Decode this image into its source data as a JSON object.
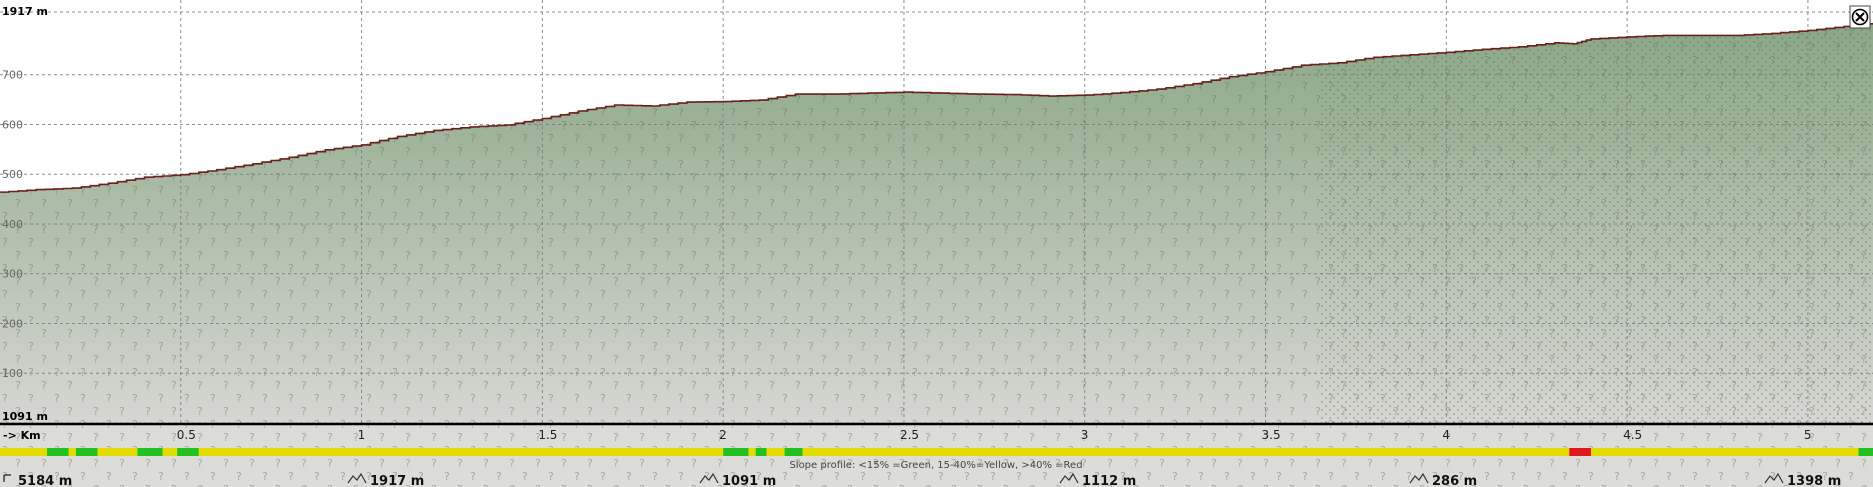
{
  "window": {
    "close_icon": "close-icon"
  },
  "chart_data": {
    "type": "area",
    "x": [
      0,
      0.1,
      0.2,
      0.3,
      0.4,
      0.5,
      0.6,
      0.7,
      0.8,
      0.9,
      1.0,
      1.1,
      1.2,
      1.3,
      1.4,
      1.5,
      1.6,
      1.7,
      1.8,
      1.9,
      2.0,
      2.1,
      2.2,
      2.3,
      2.4,
      2.5,
      2.6,
      2.7,
      2.8,
      2.9,
      3.0,
      3.1,
      3.2,
      3.3,
      3.4,
      3.5,
      3.6,
      3.7,
      3.8,
      3.9,
      4.0,
      4.1,
      4.2,
      4.3,
      4.35,
      4.4,
      4.5,
      4.6,
      4.7,
      4.8,
      4.9,
      5.0,
      5.1,
      5.18
    ],
    "values": [
      1555,
      1560,
      1563,
      1573,
      1585,
      1590,
      1600,
      1612,
      1625,
      1640,
      1650,
      1667,
      1679,
      1686,
      1690,
      1703,
      1718,
      1730,
      1728,
      1736,
      1737,
      1740,
      1752,
      1752,
      1754,
      1756,
      1754,
      1752,
      1751,
      1748,
      1750,
      1755,
      1762,
      1773,
      1787,
      1797,
      1810,
      1815,
      1826,
      1831,
      1836,
      1842,
      1847,
      1855,
      1853,
      1863,
      1867,
      1870,
      1870,
      1870,
      1874,
      1880,
      1888,
      1895
    ],
    "ylim": [
      1091,
      1917
    ],
    "xlim": [
      0,
      5.18
    ],
    "y_ticks": [
      {
        "value": 1917,
        "label": "1917 m"
      },
      {
        "value": 1791,
        "label": "700"
      },
      {
        "value": 1691,
        "label": "600"
      },
      {
        "value": 1591,
        "label": "500"
      },
      {
        "value": 1491,
        "label": "400"
      },
      {
        "value": 1391,
        "label": "300"
      },
      {
        "value": 1291,
        "label": "200"
      },
      {
        "value": 1191,
        "label": "100"
      },
      {
        "value": 1091,
        "label": "1091 m"
      }
    ],
    "x_ticks": [
      {
        "value": 0,
        "label": "-> Km"
      },
      {
        "value": 0.5,
        "label": "0.5"
      },
      {
        "value": 1,
        "label": "1"
      },
      {
        "value": 1.5,
        "label": "1.5"
      },
      {
        "value": 2,
        "label": "2"
      },
      {
        "value": 2.5,
        "label": "2.5"
      },
      {
        "value": 3,
        "label": "3"
      },
      {
        "value": 3.5,
        "label": "3.5"
      },
      {
        "value": 4,
        "label": "4"
      },
      {
        "value": 4.5,
        "label": "4.5"
      },
      {
        "value": 5,
        "label": "5"
      }
    ],
    "grid": true,
    "colors": {
      "line": "#6b1f1f",
      "fill_top": "#8aa785",
      "fill_bottom": "#d6d6d2",
      "grid": "#7a7a7a",
      "slope_green": "#22c020",
      "slope_yellow": "#e4dc00",
      "slope_red": "#e01a1a"
    },
    "slope_profile": {
      "legend": "Slope profile: <15% =Green, 15-40%=Yellow, >40% =Red",
      "segments": [
        {
          "from": 0.0,
          "to": 0.13,
          "color": "yellow"
        },
        {
          "from": 0.13,
          "to": 0.19,
          "color": "green"
        },
        {
          "from": 0.19,
          "to": 0.21,
          "color": "yellow"
        },
        {
          "from": 0.21,
          "to": 0.27,
          "color": "green"
        },
        {
          "from": 0.27,
          "to": 0.38,
          "color": "yellow"
        },
        {
          "from": 0.38,
          "to": 0.45,
          "color": "green"
        },
        {
          "from": 0.45,
          "to": 0.49,
          "color": "yellow"
        },
        {
          "from": 0.49,
          "to": 0.55,
          "color": "green"
        },
        {
          "from": 0.55,
          "to": 2.0,
          "color": "yellow"
        },
        {
          "from": 2.0,
          "to": 2.07,
          "color": "green"
        },
        {
          "from": 2.07,
          "to": 2.09,
          "color": "yellow"
        },
        {
          "from": 2.09,
          "to": 2.12,
          "color": "green"
        },
        {
          "from": 2.12,
          "to": 2.17,
          "color": "yellow"
        },
        {
          "from": 2.17,
          "to": 2.22,
          "color": "green"
        },
        {
          "from": 2.22,
          "to": 4.34,
          "color": "yellow"
        },
        {
          "from": 4.34,
          "to": 4.4,
          "color": "red"
        },
        {
          "from": 4.4,
          "to": 5.14,
          "color": "yellow"
        },
        {
          "from": 5.14,
          "to": 5.18,
          "color": "green"
        }
      ]
    },
    "stats": [
      {
        "icon": "distance-icon",
        "value": "5184 m"
      },
      {
        "icon": "max-elevation-icon",
        "value": "1917 m"
      },
      {
        "icon": "min-elevation-icon",
        "value": "1091 m"
      },
      {
        "icon": "ascent-icon",
        "value": "1112 m"
      },
      {
        "icon": "descent-icon",
        "value": "286 m"
      },
      {
        "icon": "elevation-diff-icon",
        "value": "1398 m"
      }
    ]
  }
}
